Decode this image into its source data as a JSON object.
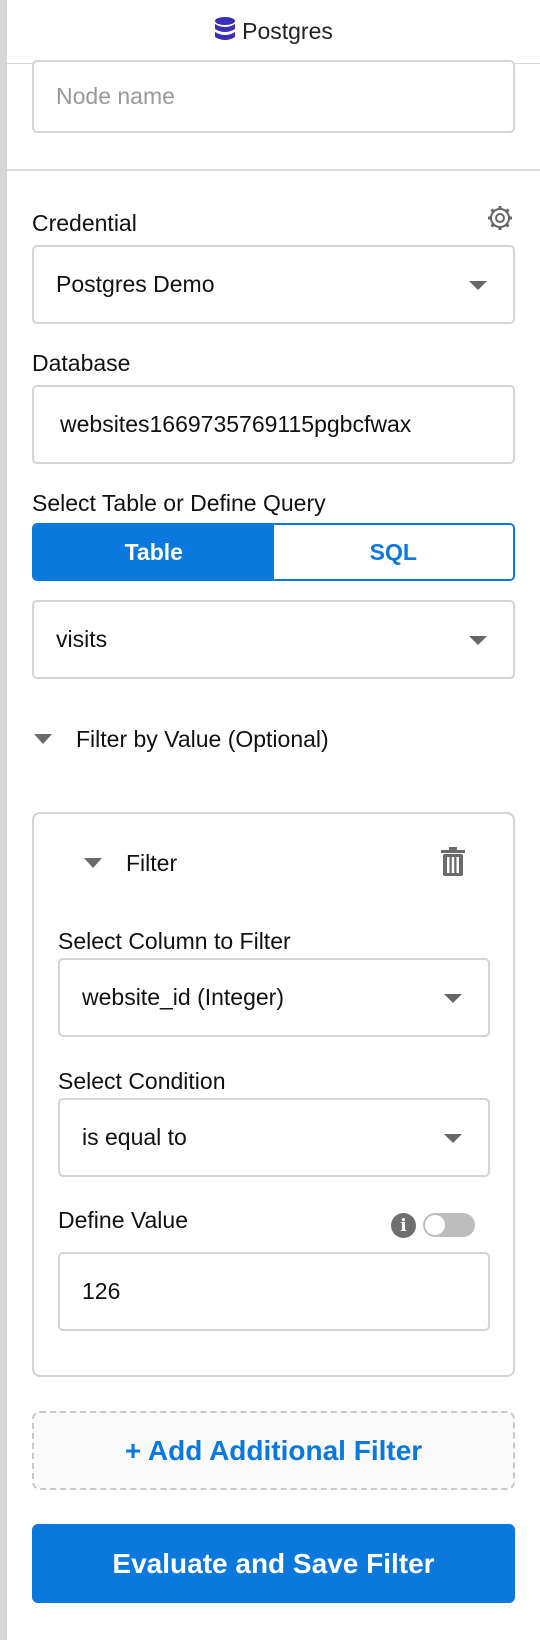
{
  "header": {
    "title": "Postgres",
    "icon": "database-icon",
    "icon_color": "#3b2fb8"
  },
  "node_name": {
    "placeholder": "Node name",
    "value": ""
  },
  "credential": {
    "label": "Credential",
    "value": "Postgres Demo",
    "settings_icon": "gear-icon"
  },
  "database": {
    "label": "Database",
    "value": "websites1669735769115pgbcfwax"
  },
  "source": {
    "label": "Select Table or Define Query",
    "options": [
      "Table",
      "SQL"
    ],
    "selected": "Table",
    "table_value": "visits"
  },
  "filter_section": {
    "label": "Filter by Value (Optional)",
    "filter": {
      "title": "Filter",
      "column_label": "Select Column to Filter",
      "column_value": "website_id (Integer)",
      "condition_label": "Select Condition",
      "condition_value": "is equal to",
      "value_label": "Define Value",
      "value": "126",
      "toggle_on": false
    },
    "add_label": "+ Add Additional Filter"
  },
  "save_button": {
    "label": "Evaluate and Save Filter"
  },
  "colors": {
    "accent": "#0b78de",
    "border": "#d4d4d4"
  }
}
